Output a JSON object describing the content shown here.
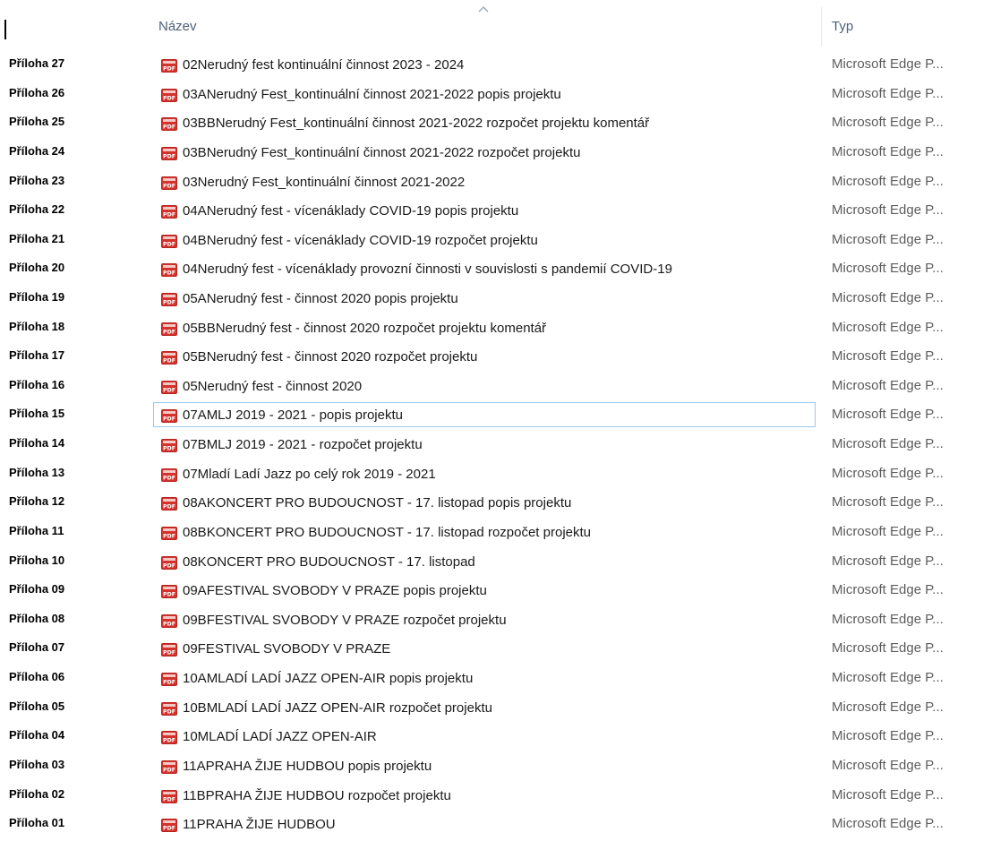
{
  "header": {
    "name_label": "Název",
    "type_label": "Typ"
  },
  "rows": [
    {
      "attachment": "Příloha 27",
      "name": "02Nerudný fest kontinuální činnost 2023 - 2024",
      "type": "Microsoft Edge P..."
    },
    {
      "attachment": "Příloha 26",
      "name": "03ANerudný Fest_kontinuální činnost 2021-2022 popis projektu",
      "type": "Microsoft Edge P..."
    },
    {
      "attachment": "Příloha 25",
      "name": "03BBNerudný Fest_kontinuální činnost 2021-2022 rozpočet projektu komentář",
      "type": "Microsoft Edge P..."
    },
    {
      "attachment": "Příloha 24",
      "name": "03BNerudný Fest_kontinuální činnost 2021-2022 rozpočet projektu",
      "type": "Microsoft Edge P..."
    },
    {
      "attachment": "Příloha 23",
      "name": "03Nerudný Fest_kontinuální činnost 2021-2022",
      "type": "Microsoft Edge P..."
    },
    {
      "attachment": "Příloha 22",
      "name": "04ANerudný fest - vícenáklady COVID-19 popis projektu",
      "type": "Microsoft Edge P..."
    },
    {
      "attachment": "Příloha 21",
      "name": "04BNerudný fest - vícenáklady COVID-19 rozpočet projektu",
      "type": "Microsoft Edge P..."
    },
    {
      "attachment": "Příloha 20",
      "name": "04Nerudný fest - vícenáklady provozní činnosti v souvislosti s pandemií COVID-19",
      "type": "Microsoft Edge P..."
    },
    {
      "attachment": "Příloha 19",
      "name": "05ANerudný fest - činnost 2020 popis projektu",
      "type": "Microsoft Edge P..."
    },
    {
      "attachment": "Příloha 18",
      "name": "05BBNerudný fest - činnost 2020 rozpočet projektu komentář",
      "type": "Microsoft Edge P..."
    },
    {
      "attachment": "Příloha 17",
      "name": "05BNerudný fest - činnost 2020 rozpočet projektu",
      "type": "Microsoft Edge P..."
    },
    {
      "attachment": "Příloha 16",
      "name": "05Nerudný fest - činnost 2020",
      "type": "Microsoft Edge P..."
    },
    {
      "attachment": "Příloha 15",
      "name": "07AMLJ 2019 - 2021 - popis projektu",
      "type": "Microsoft Edge P...",
      "focused": true
    },
    {
      "attachment": "Příloha 14",
      "name": "07BMLJ 2019 - 2021 - rozpočet projektu",
      "type": "Microsoft Edge P..."
    },
    {
      "attachment": "Příloha 13",
      "name": "07Mladí Ladí Jazz po celý rok 2019 - 2021",
      "type": "Microsoft Edge P..."
    },
    {
      "attachment": "Příloha 12",
      "name": "08AKONCERT PRO BUDOUCNOST - 17. listopad popis projektu",
      "type": "Microsoft Edge P..."
    },
    {
      "attachment": "Příloha 11",
      "name": "08BKONCERT PRO BUDOUCNOST - 17. listopad rozpočet projektu",
      "type": "Microsoft Edge P..."
    },
    {
      "attachment": "Příloha 10",
      "name": "08KONCERT PRO BUDOUCNOST - 17. listopad",
      "type": "Microsoft Edge P..."
    },
    {
      "attachment": "Příloha 09",
      "name": "09AFESTIVAL SVOBODY V PRAZE popis projektu",
      "type": "Microsoft Edge P..."
    },
    {
      "attachment": "Příloha 08",
      "name": "09BFESTIVAL SVOBODY V PRAZE rozpočet projektu",
      "type": "Microsoft Edge P..."
    },
    {
      "attachment": "Příloha 07",
      "name": "09FESTIVAL SVOBODY V PRAZE",
      "type": "Microsoft Edge P..."
    },
    {
      "attachment": "Příloha 06",
      "name": "10AMLADÍ LADÍ  JAZZ OPEN-AIR popis projektu",
      "type": "Microsoft Edge P..."
    },
    {
      "attachment": "Příloha 05",
      "name": "10BMLADÍ LADÍ  JAZZ OPEN-AIR rozpočet projektu",
      "type": "Microsoft Edge P..."
    },
    {
      "attachment": "Příloha 04",
      "name": "10MLADÍ LADÍ  JAZZ OPEN-AIR",
      "type": "Microsoft Edge P..."
    },
    {
      "attachment": "Příloha 03",
      "name": "11APRAHA ŽIJE HUDBOU popis projektu",
      "type": "Microsoft Edge P..."
    },
    {
      "attachment": "Příloha 02",
      "name": "11BPRAHA ŽIJE HUDBOU rozpočet projektu",
      "type": "Microsoft Edge P..."
    },
    {
      "attachment": "Příloha 01",
      "name": "11PRAHA ŽIJE HUDBOU",
      "type": "Microsoft Edge P..."
    }
  ],
  "icons": {
    "file_icon": "pdf-file-icon",
    "sort_icon": "sort-ascending-icon"
  },
  "colors": {
    "header_text": "#4c607a",
    "pdf_red": "#d4322c",
    "focus_border": "#99c9ef"
  }
}
